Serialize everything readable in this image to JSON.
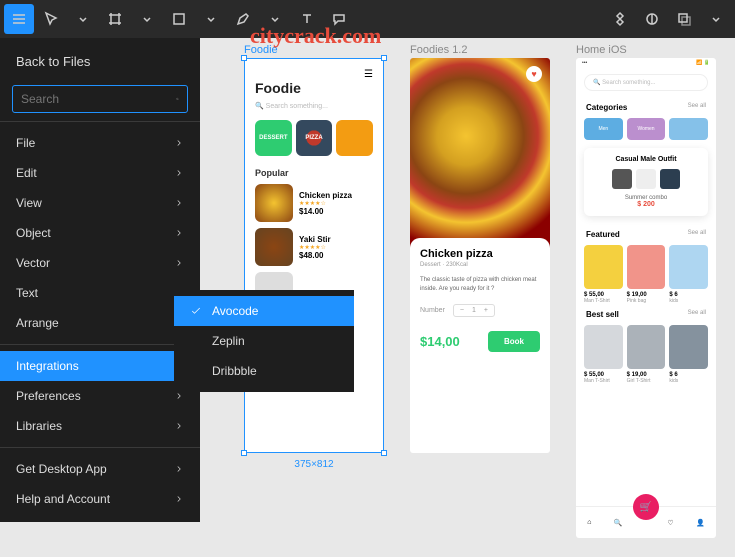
{
  "toolbar": {
    "icons": [
      "menu",
      "pointer",
      "frame",
      "rect",
      "pen",
      "line",
      "text",
      "comment"
    ],
    "right_icons": [
      "components",
      "contrast",
      "layers"
    ]
  },
  "menu": {
    "back": "Back to Files",
    "search_placeholder": "Search",
    "groups": [
      [
        "File",
        "Edit",
        "View",
        "Object",
        "Vector",
        "Text",
        "Arrange"
      ],
      [
        "Integrations",
        "Preferences",
        "Libraries"
      ],
      [
        "Get Desktop App",
        "Help and Account"
      ]
    ],
    "highlighted": "Integrations"
  },
  "submenu": {
    "items": [
      "Avocode",
      "Zeplin",
      "Dribbble"
    ],
    "selected": "Avocode"
  },
  "watermark": "citycrack.com",
  "artboards": {
    "a1": {
      "label": "Foodie",
      "dim": "375×812",
      "title": "Foodie",
      "search": "Search something...",
      "cats": [
        {
          "name": "DESSERT",
          "color": "#2ecc71"
        },
        {
          "name": "PIZZA",
          "color": "#34495e"
        },
        {
          "name": "",
          "color": "#f39c12"
        }
      ],
      "popular": "Popular",
      "items": [
        {
          "name": "Chicken pizza",
          "price": "$14.00"
        },
        {
          "name": "Yaki Stir",
          "price": "$48.00"
        }
      ]
    },
    "a2": {
      "label": "Foodies 1.2",
      "title": "Chicken pizza",
      "sub": "Dessert · 230Kcal",
      "desc": "The classic taste of pizza with chicken meat inside. Are you ready for it ?",
      "qty_label": "Number",
      "qty": "1",
      "price": "$14,00",
      "book": "Book"
    },
    "a3": {
      "label": "Home iOS",
      "search": "Search something...",
      "categories": "Categories",
      "see": "See all",
      "cats": [
        {
          "name": "Men",
          "color": "#5dade2"
        },
        {
          "name": "Women",
          "color": "#bb8fce"
        },
        {
          "name": "",
          "color": "#85c1e9"
        }
      ],
      "outfit_title": "Casual Male Outfit",
      "combo": "Summer combo",
      "combo_price": "$ 200",
      "featured": "Featured",
      "featured_items": [
        {
          "price": "$ 55,00",
          "name": "Man T-Shirt",
          "color": "#f4d03f"
        },
        {
          "price": "$ 19,00",
          "name": "Pink bag",
          "color": "#f1948a"
        },
        {
          "price": "$ 6",
          "name": "kids",
          "color": "#aed6f1"
        }
      ],
      "bestsell": "Best sell",
      "bestsell_items": [
        {
          "price": "$ 55,00",
          "name": "Man T-Shirt",
          "color": "#d5d8dc"
        },
        {
          "price": "$ 19,00",
          "name": "Girl T-Shirt",
          "color": "#abb2b9"
        },
        {
          "price": "$ 6",
          "name": "kids",
          "color": "#85929e"
        }
      ]
    }
  }
}
